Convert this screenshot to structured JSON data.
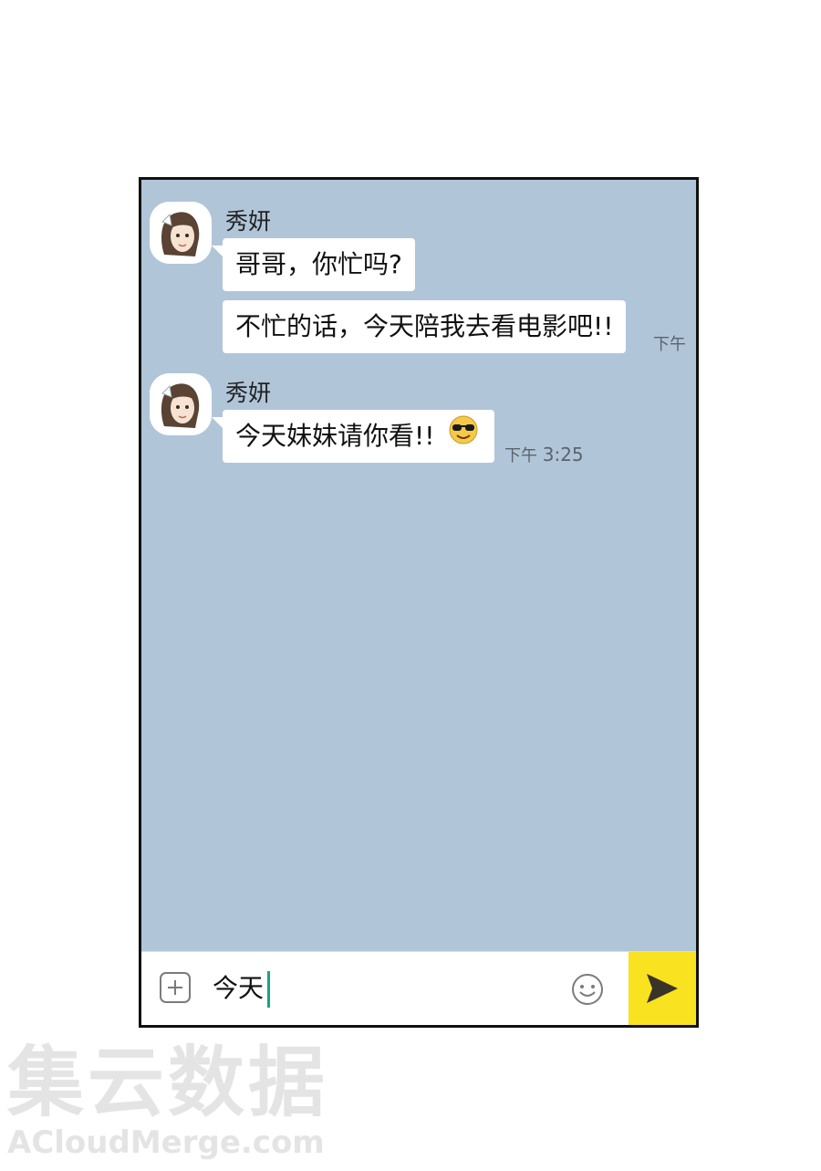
{
  "messages": [
    {
      "sender": "秀妍",
      "bubbles": [
        "哥哥，你忙吗?",
        "不忙的话，今天陪我去看电影吧!!"
      ],
      "time": "下午"
    },
    {
      "sender": "秀妍",
      "bubbles": [
        "今天妹妹请你看!!"
      ],
      "emoji": "sunglasses-emoji",
      "time_prefix": "下午",
      "time_value": "3:25"
    }
  ],
  "input": {
    "text": "今天"
  },
  "icons": {
    "attach": "plus-square-icon",
    "emoji": "smiley-icon",
    "send": "send-arrow-icon"
  },
  "colors": {
    "chat_background": "#b1c5d9",
    "send_button": "#f9e21f",
    "caret": "#1aa37a"
  },
  "watermark": {
    "cn": "集云数据",
    "en": "ACloudMerge.com"
  }
}
